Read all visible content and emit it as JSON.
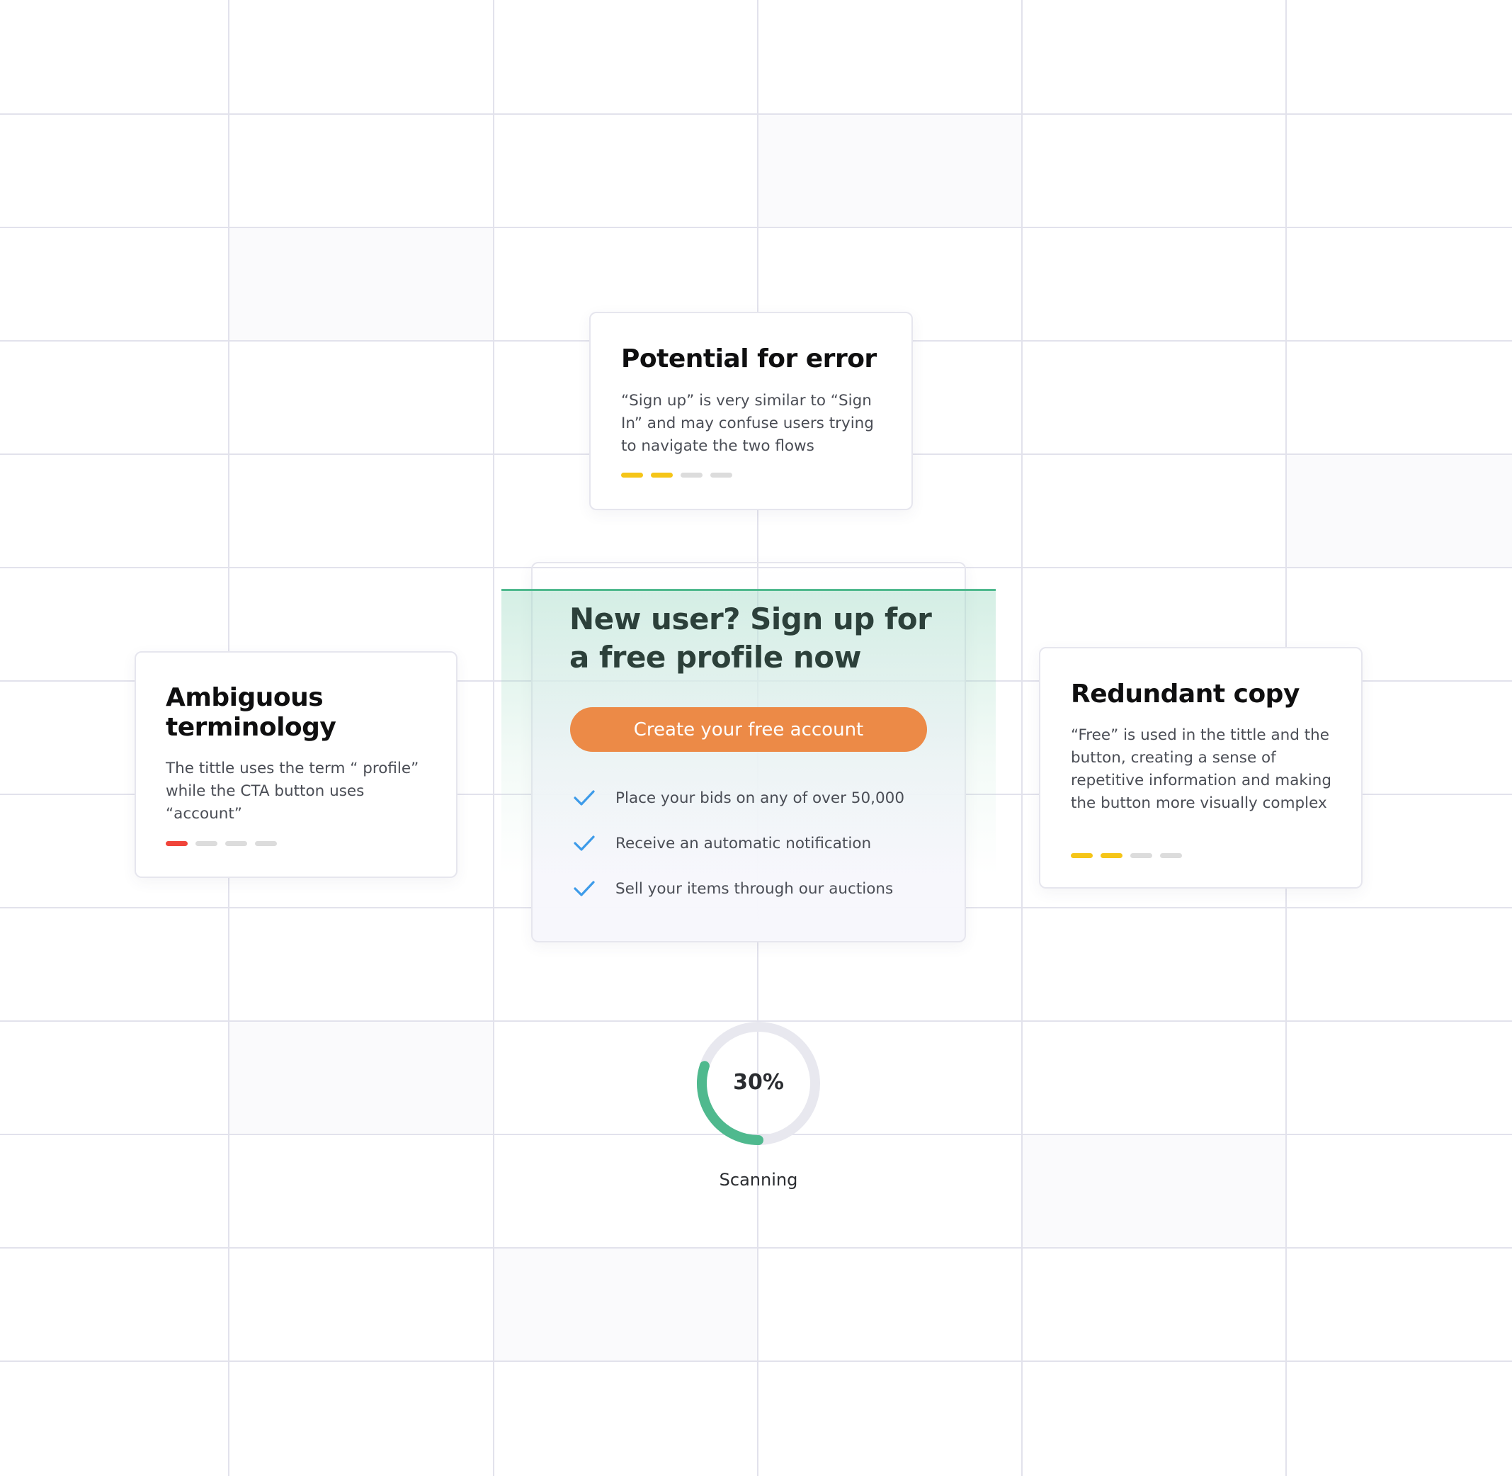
{
  "issues": {
    "potential_error": {
      "title": "Potential for error",
      "description": "“Sign up” is very similar to “Sign In” and may confuse users trying to navigate the two flows",
      "severity": {
        "level": 2,
        "max": 4,
        "color": "#f5c518"
      }
    },
    "ambiguous_terminology": {
      "title": "Ambiguous terminology",
      "description": "The tittle uses the term “ profile” while the CTA button uses “account”",
      "severity": {
        "level": 1,
        "max": 4,
        "color": "#f0443a"
      }
    },
    "redundant_copy": {
      "title": "Redundant copy",
      "description": "“Free” is used in the tittle and the button, creating a sense of repetitive information and making the button more visually complex",
      "severity": {
        "level": 2,
        "max": 4,
        "color": "#f5c518"
      }
    }
  },
  "signup": {
    "title": "New user? Sign up for a free profile now",
    "cta_label": "Create your free account",
    "benefits": [
      {
        "text": "Place your bids on any of over 50,000",
        "icon": "check-icon"
      },
      {
        "text": "Receive an automatic notification",
        "icon": "check-icon"
      },
      {
        "text": "Sell your items through our auctions",
        "icon": "check-icon"
      }
    ]
  },
  "scan": {
    "progress_label": "30%",
    "progress_fraction": 0.3,
    "status": "Scanning"
  },
  "colors": {
    "accent_green": "#4fb98e",
    "cta_orange": "#ec8a47",
    "check_blue": "#3d9be9",
    "severity_yellow": "#f5c518",
    "severity_red": "#f0443a"
  }
}
